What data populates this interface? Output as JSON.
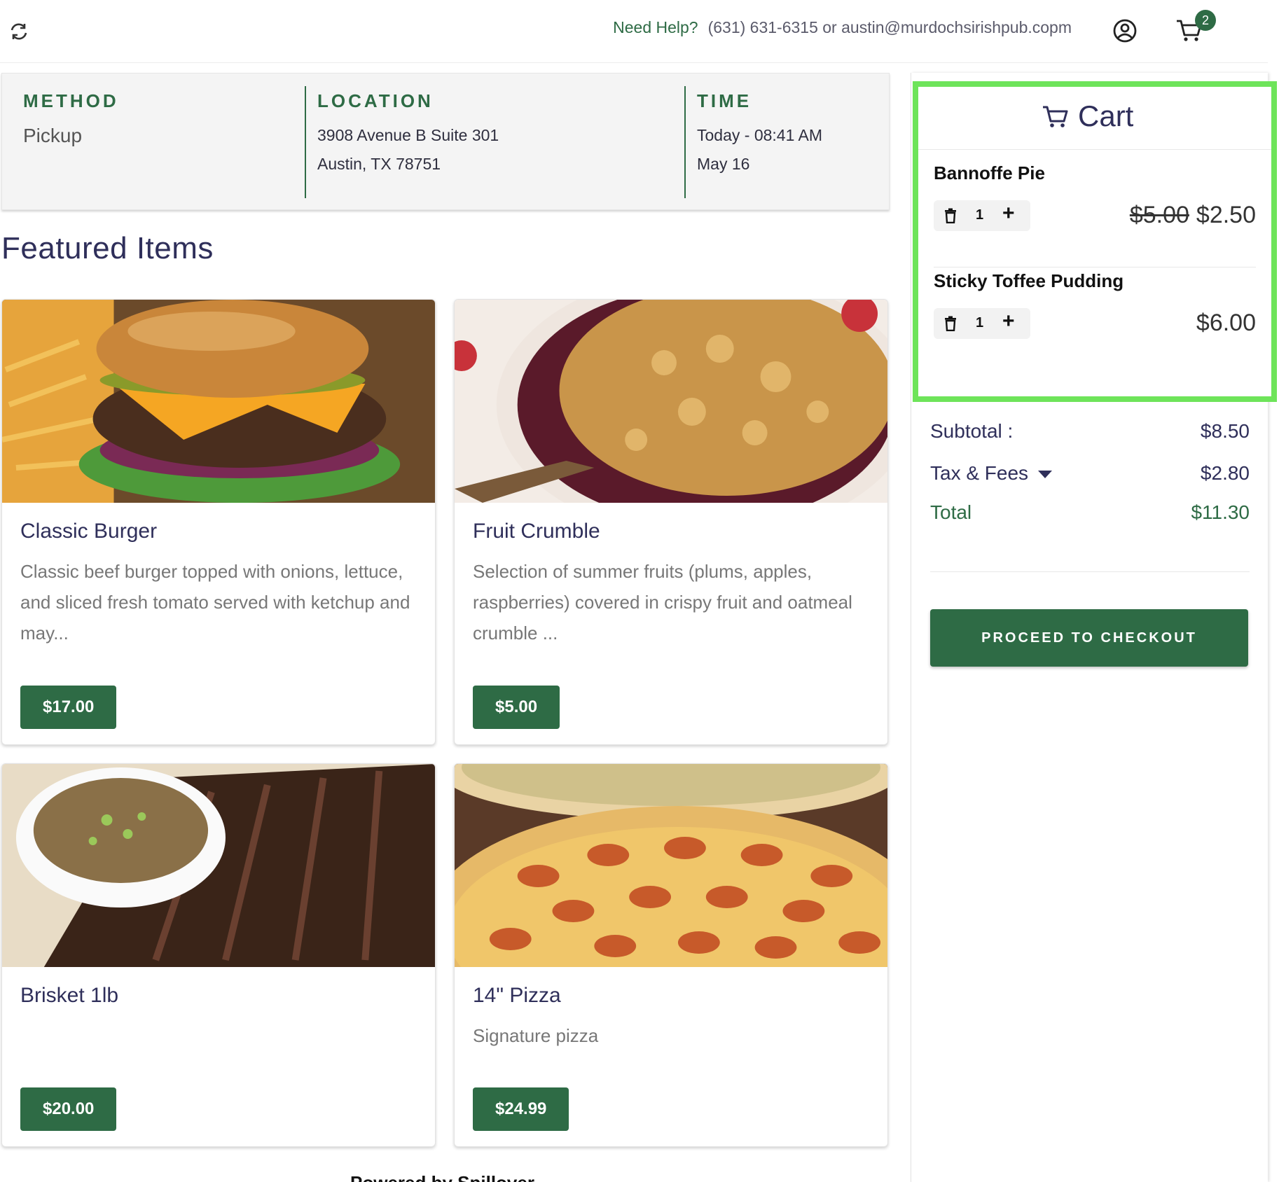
{
  "header": {
    "need_help": "Need Help?",
    "contact": "(631) 631-6315 or austin@murdochsirishpub.copm",
    "cart_count": "2",
    "icons": [
      "refresh-icon",
      "account-icon",
      "cart-icon"
    ]
  },
  "order": {
    "method_label": "METHOD",
    "method_value": "Pickup",
    "location_label": "LOCATION",
    "location_line1": "3908 Avenue B Suite 301",
    "location_line2": "Austin, TX 78751",
    "time_label": "TIME",
    "time_line1": "Today - 08:41 AM",
    "time_line2": "May 16"
  },
  "featured": {
    "title": "Featured Items",
    "items": [
      {
        "name": "Classic Burger",
        "description": "Classic beef burger topped with onions, lettuce, and sliced fresh tomato served with ketchup and may...",
        "price": "$17.00"
      },
      {
        "name": "Fruit Crumble",
        "description": "Selection of summer fruits (plums, apples, raspberries) covered in crispy fruit and oatmeal crumble ...",
        "price": "$5.00"
      },
      {
        "name": "Brisket 1lb",
        "description": "",
        "price": "$20.00"
      },
      {
        "name": "14\" Pizza",
        "description": "Signature pizza",
        "price": "$24.99"
      }
    ]
  },
  "cart": {
    "title": "Cart",
    "items": [
      {
        "name": "Bannoffe Pie",
        "qty": "1",
        "old_price": "$5.00",
        "price": "$2.50"
      },
      {
        "name": "Sticky Toffee Pudding",
        "qty": "1",
        "price": "$6.00"
      }
    ],
    "subtotal_label": "Subtotal :",
    "subtotal": "$8.50",
    "tax_label": "Tax & Fees",
    "tax": "$2.80",
    "total_label": "Total",
    "total": "$11.30",
    "checkout_label": "PROCEED TO CHECKOUT"
  },
  "footer": {
    "powered_by": "Powered by Spillover"
  },
  "colors": {
    "brand_green": "#2e6b45",
    "highlight": "#6ee45a",
    "heading": "#2f2f5a"
  }
}
